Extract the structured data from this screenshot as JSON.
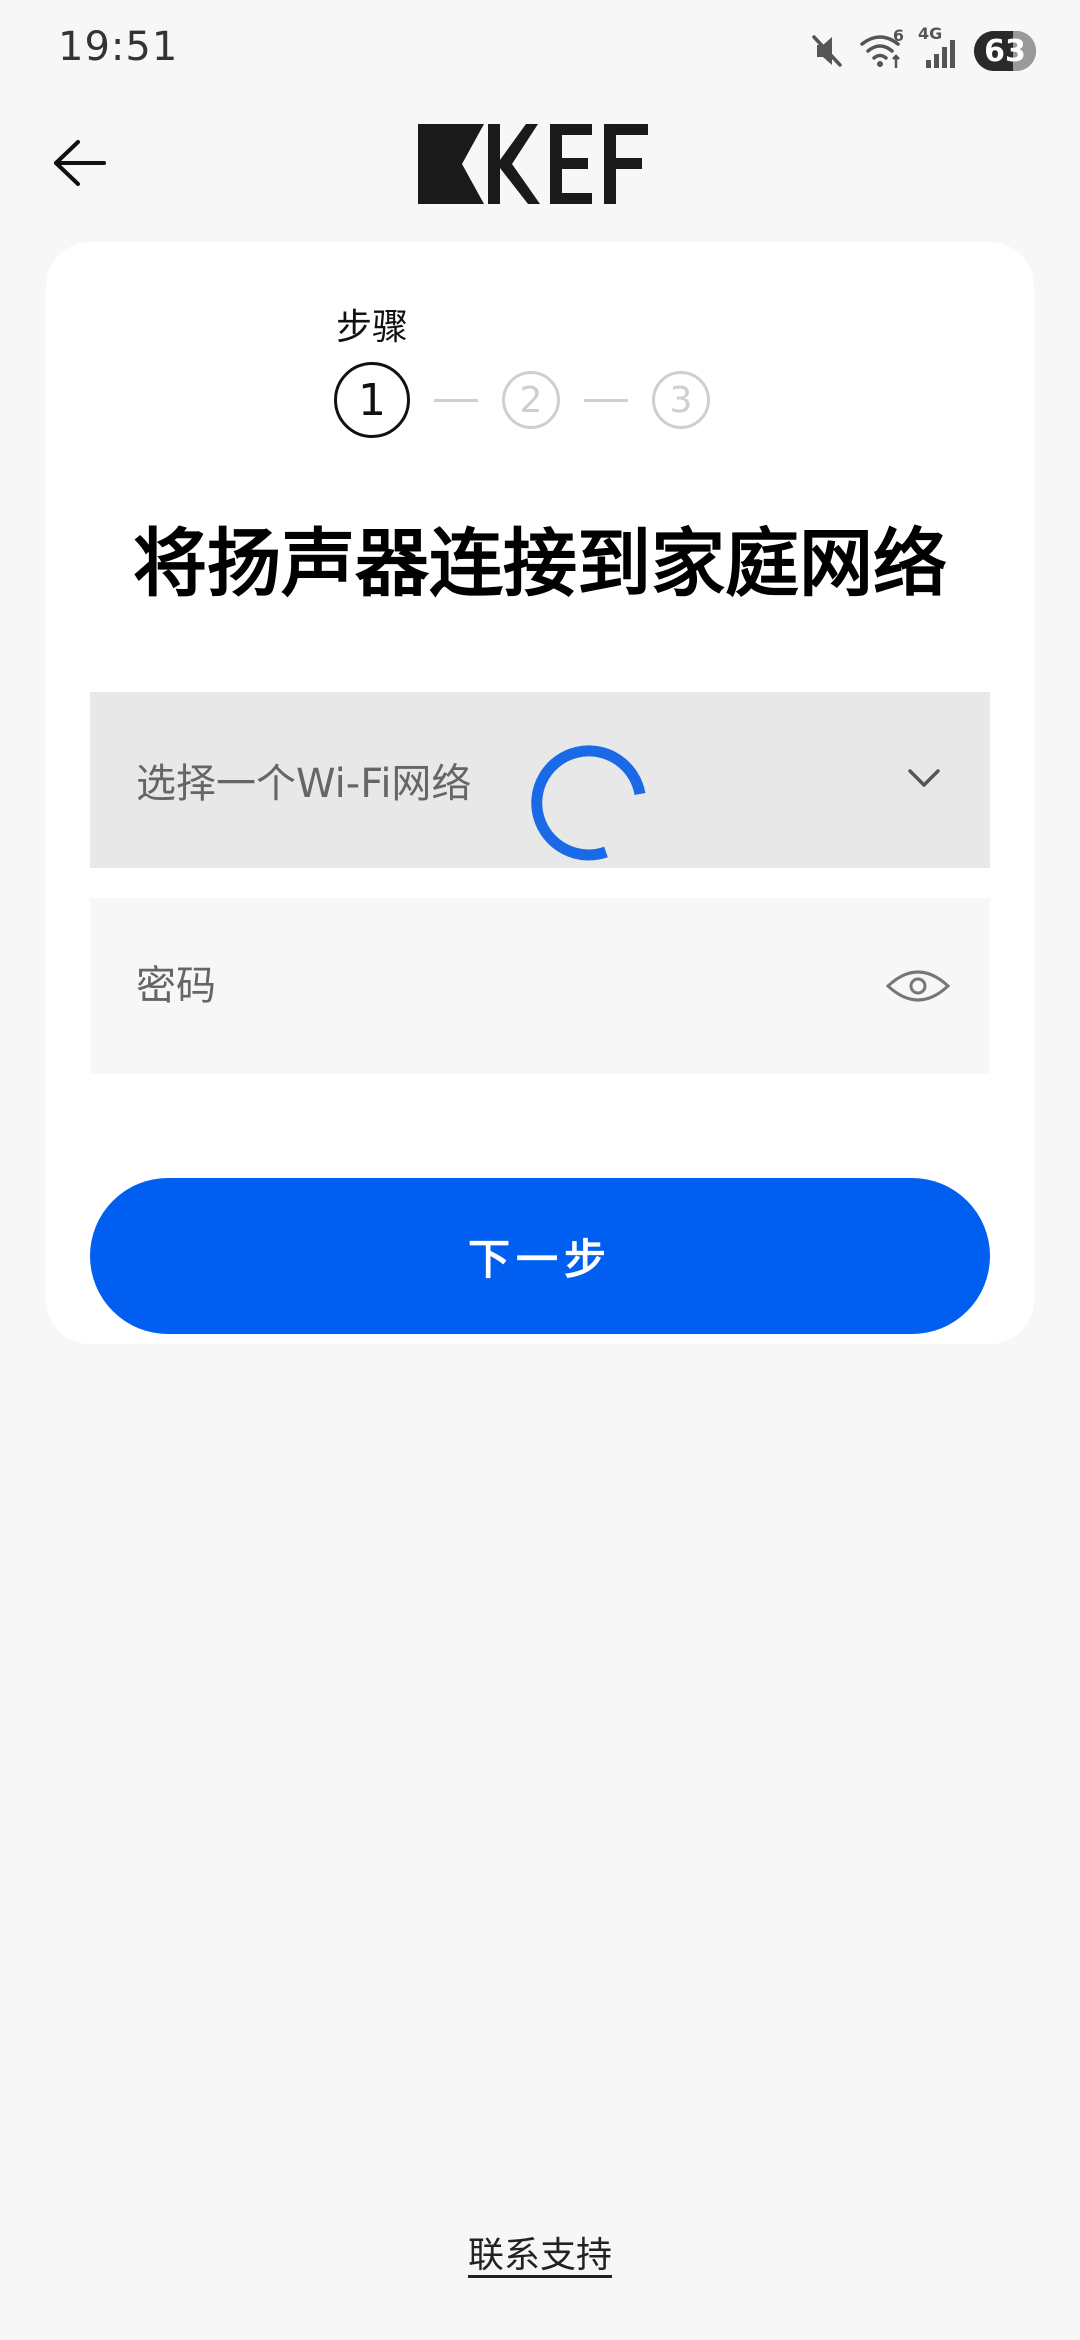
{
  "status_bar": {
    "time": "19:51",
    "battery_level": 63,
    "battery_text": "63",
    "network_label": "4G",
    "wifi_label": "6"
  },
  "header": {
    "back_icon": "arrow-left-icon",
    "logo_text": "KEF"
  },
  "stepper": {
    "label": "步骤",
    "steps": [
      "1",
      "2",
      "3"
    ],
    "current": 1
  },
  "main": {
    "title": "将扬声器连接到家庭网络",
    "wifi_select": {
      "placeholder": "选择一个Wi-Fi网络",
      "loading": true
    },
    "password": {
      "placeholder": "密码",
      "value": ""
    },
    "next_label": "下一步"
  },
  "footer": {
    "support_label": "联系支持"
  },
  "colors": {
    "accent": "#005ff0",
    "background": "#f7f7f7",
    "card": "#ffffff"
  }
}
